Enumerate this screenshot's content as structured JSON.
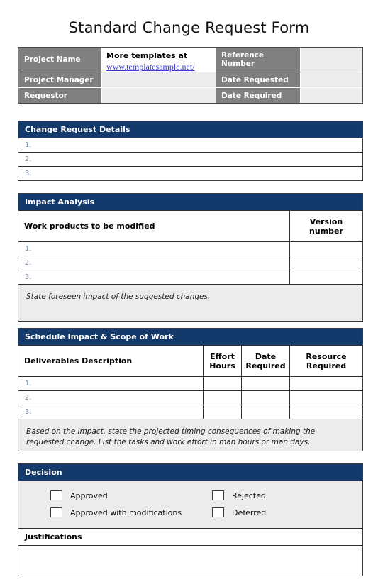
{
  "document": {
    "title": "Standard Change Request Form"
  },
  "colors": {
    "section_header_bg": "#143a6b",
    "label_cell_bg": "#808080",
    "value_cell_bg": "#ececec",
    "note_band_bg": "#ececec",
    "link": "#3b3bd0",
    "row_number": "#7a90a8"
  },
  "info_table": {
    "rows": [
      {
        "label": "Project Name",
        "promo_text": "More templates at",
        "promo_link": "www.templatesample.net/",
        "label2": "Reference Number",
        "value2": ""
      },
      {
        "label": "Project Manager",
        "value": "",
        "label2": "Date Requested",
        "value2": ""
      },
      {
        "label": "Requestor",
        "value": "",
        "label2": "Date Required",
        "value2": ""
      }
    ]
  },
  "change_request_details": {
    "header": "Change Request Details",
    "rows": [
      "1.",
      "2.",
      "3."
    ]
  },
  "impact_analysis": {
    "header": "Impact Analysis",
    "columns": [
      "Work products to be modified",
      "Version number"
    ],
    "rows": [
      "1.",
      "2.",
      "3."
    ],
    "note": "State foreseen impact of the suggested changes."
  },
  "schedule_impact": {
    "header": "Schedule Impact & Scope of Work",
    "columns": [
      "Deliverables Description",
      "Effort Hours",
      "Date Required",
      "Resource Required"
    ],
    "rows": [
      "1.",
      "2.",
      "3."
    ],
    "note": "Based on the impact, state the projected timing consequences of making the requested change.  List the tasks and work effort in man hours or man days."
  },
  "decision": {
    "header": "Decision",
    "checkboxes": [
      {
        "label": "Approved",
        "checked": false
      },
      {
        "label": "Rejected",
        "checked": false
      },
      {
        "label": "Approved with modifications",
        "checked": false
      },
      {
        "label": "Deferred",
        "checked": false
      }
    ],
    "justifications_header": "Justifications",
    "justifications_value": ""
  }
}
